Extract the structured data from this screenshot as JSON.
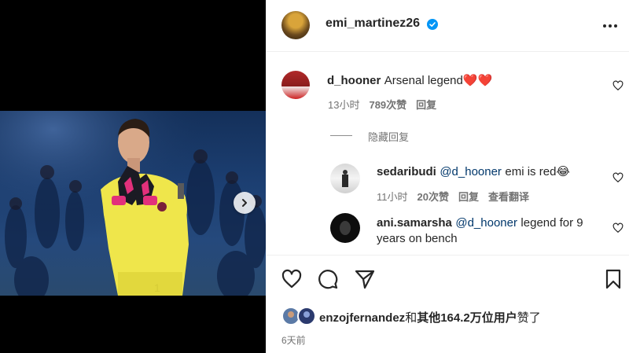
{
  "post": {
    "owner": "emi_martinez26",
    "age": "6天前",
    "likes": {
      "first_liker": "enzojfernandez",
      "joiner": "和",
      "rest": "其他164.2万位用户",
      "suffix": "赞了"
    }
  },
  "comments": [
    {
      "username": "d_hooner",
      "text": "Arsenal legend",
      "emoji": "❤️❤️",
      "time": "13小时",
      "likes": "789次赞",
      "reply": "回复"
    }
  ],
  "hidden_replies_label": "隐藏回复",
  "replies": [
    {
      "username": "sedaribudi",
      "mention": "@d_hooner",
      "text": "emi is red",
      "emoji": "😂",
      "time": "11小时",
      "likes": "20次赞",
      "reply": "回复",
      "translate": "查看翻译"
    },
    {
      "username": "ani.samarsha",
      "mention": "@d_hooner",
      "text": "legend for 9 years on bench"
    }
  ],
  "icons": {
    "verified": "verified-badge-icon",
    "more": "more-options-icon",
    "like": "heart-icon",
    "comment": "comment-icon",
    "share": "send-icon",
    "save": "bookmark-icon",
    "next": "chevron-right-icon"
  },
  "colors": {
    "verified": "#0095f6",
    "heart_emoji": "#ed4956",
    "mention": "#00376b",
    "secondary_text": "#737373",
    "jersey": "#f2e84b"
  }
}
